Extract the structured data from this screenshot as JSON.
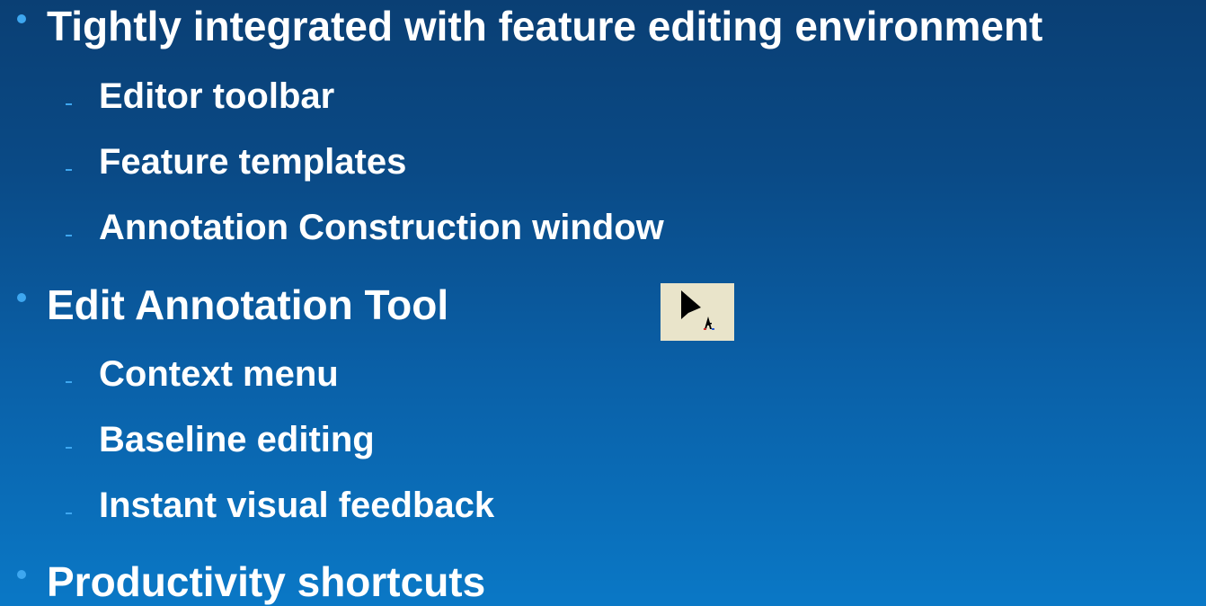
{
  "slide": {
    "bullets": [
      {
        "text": "Tightly integrated with feature editing environment",
        "sub": [
          "Editor toolbar",
          "Feature templates",
          "Annotation Construction window"
        ]
      },
      {
        "text": "Edit Annotation Tool",
        "sub": [
          "Context menu",
          "Baseline editing",
          "Instant visual feedback"
        ]
      },
      {
        "text": "Productivity shortcuts",
        "sub": []
      }
    ]
  },
  "icons": {
    "edit_annotation_tool": "edit-annotation-tool-icon"
  },
  "colors": {
    "background_top": "#0a3f74",
    "background_bottom": "#0a78c6",
    "text": "#ffffff",
    "bullet": "#3ea7f0",
    "icon_background": "#e9e4ca"
  }
}
